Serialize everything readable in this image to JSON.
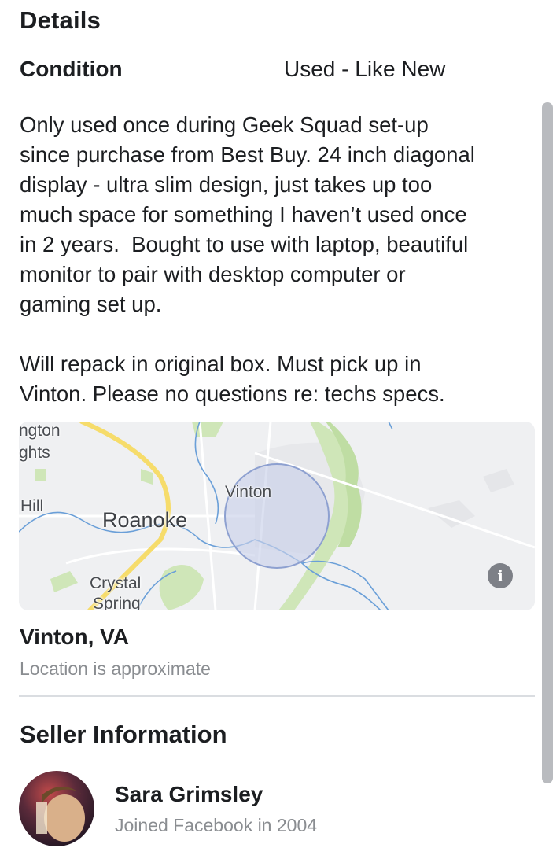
{
  "details": {
    "title": "Details",
    "condition_label": "Condition",
    "condition_value": "Used - Like New",
    "description": "Only used once during Geek Squad set-up\nsince purchase from Best Buy. 24 inch diagonal\ndisplay - ultra slim design, just takes up too\nmuch space for something I haven’t used once\nin 2 years.  Bought to use with laptop, beautiful\nmonitor to pair with desktop computer or\ngaming set up.\n\nWill repack in original box. Must pick up in\nVinton. Please no questions re: techs specs."
  },
  "map": {
    "labels": {
      "top_left_1": "ngton",
      "top_left_2": "ghts",
      "hill": "Hill",
      "roanoke": "Roanoke",
      "vinton": "Vinton",
      "crystal": "Crystal",
      "spring": "Spring"
    },
    "info_icon": "info-icon",
    "colors": {
      "road_major": "#f6dc6b",
      "water": "#6a9fd8",
      "park": "#c8e3b0",
      "radius_fill": "#c9d1ea",
      "radius_stroke": "#8da0d0"
    }
  },
  "location": {
    "title": "Vinton, VA",
    "subtitle": "Location is approximate"
  },
  "seller": {
    "title": "Seller Information",
    "name": "Sara Grimsley",
    "joined": "Joined Facebook in 2004"
  }
}
